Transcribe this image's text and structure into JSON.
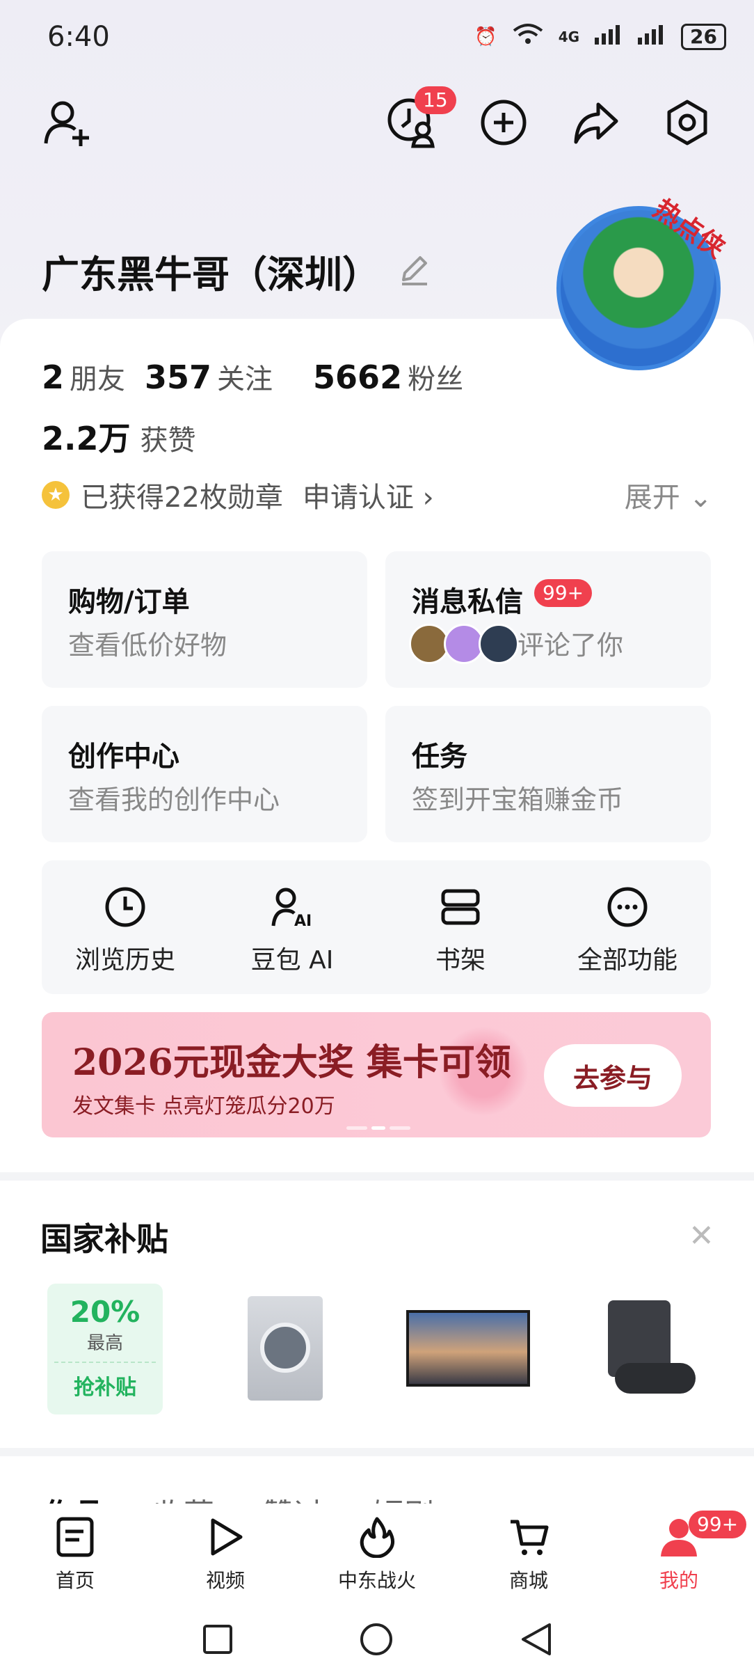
{
  "status_bar": {
    "time": "6:40",
    "network": "4G",
    "battery": "26"
  },
  "header": {
    "notification_count": "15"
  },
  "profile": {
    "name": "广东黑牛哥（深圳）",
    "avatar_tag": "热点侠"
  },
  "stats": {
    "friends_value": "2",
    "friends_label": "朋友",
    "following_value": "357",
    "following_label": "关注",
    "fans_value": "5662",
    "fans_label": "粉丝",
    "likes_value": "2.2万",
    "likes_label": "获赞"
  },
  "medals": {
    "text": "已获得22枚勋章",
    "certify": "申请认证",
    "expand": "展开"
  },
  "cards": {
    "shopping": {
      "title": "购物/订单",
      "sub": "查看低价好物"
    },
    "messages": {
      "title": "消息私信",
      "badge": "99+",
      "sub": "评论了你"
    },
    "creator": {
      "title": "创作中心",
      "sub": "查看我的创作中心"
    },
    "tasks": {
      "title": "任务",
      "sub": "签到开宝箱赚金币"
    }
  },
  "quick_actions": [
    {
      "label": "浏览历史",
      "icon": "clock-icon"
    },
    {
      "label": "豆包 AI",
      "icon": "ai-assistant-icon"
    },
    {
      "label": "书架",
      "icon": "bookshelf-icon"
    },
    {
      "label": "全部功能",
      "icon": "more-icon"
    }
  ],
  "banner": {
    "title": "2026元现金大奖 集卡可领",
    "sub": "发文集卡 点亮灯笼瓜分20万",
    "button": "去参与"
  },
  "subsidy": {
    "title": "国家补贴",
    "percent": "20%",
    "top_label": "最高",
    "grab": "抢补贴"
  },
  "tabs_peek": [
    "作品",
    "收藏",
    "赞过",
    "短剧"
  ],
  "bottom_nav": [
    {
      "label": "首页",
      "icon": "home-icon"
    },
    {
      "label": "视频",
      "icon": "play-icon"
    },
    {
      "label": "中东战火",
      "icon": "fire-icon"
    },
    {
      "label": "商城",
      "icon": "cart-icon"
    },
    {
      "label": "我的",
      "icon": "profile-icon",
      "badge": "99+"
    }
  ],
  "colors": {
    "accent_red": "#f0404e",
    "banner_text": "#8a1d24",
    "subsidy_green": "#22b35e"
  }
}
